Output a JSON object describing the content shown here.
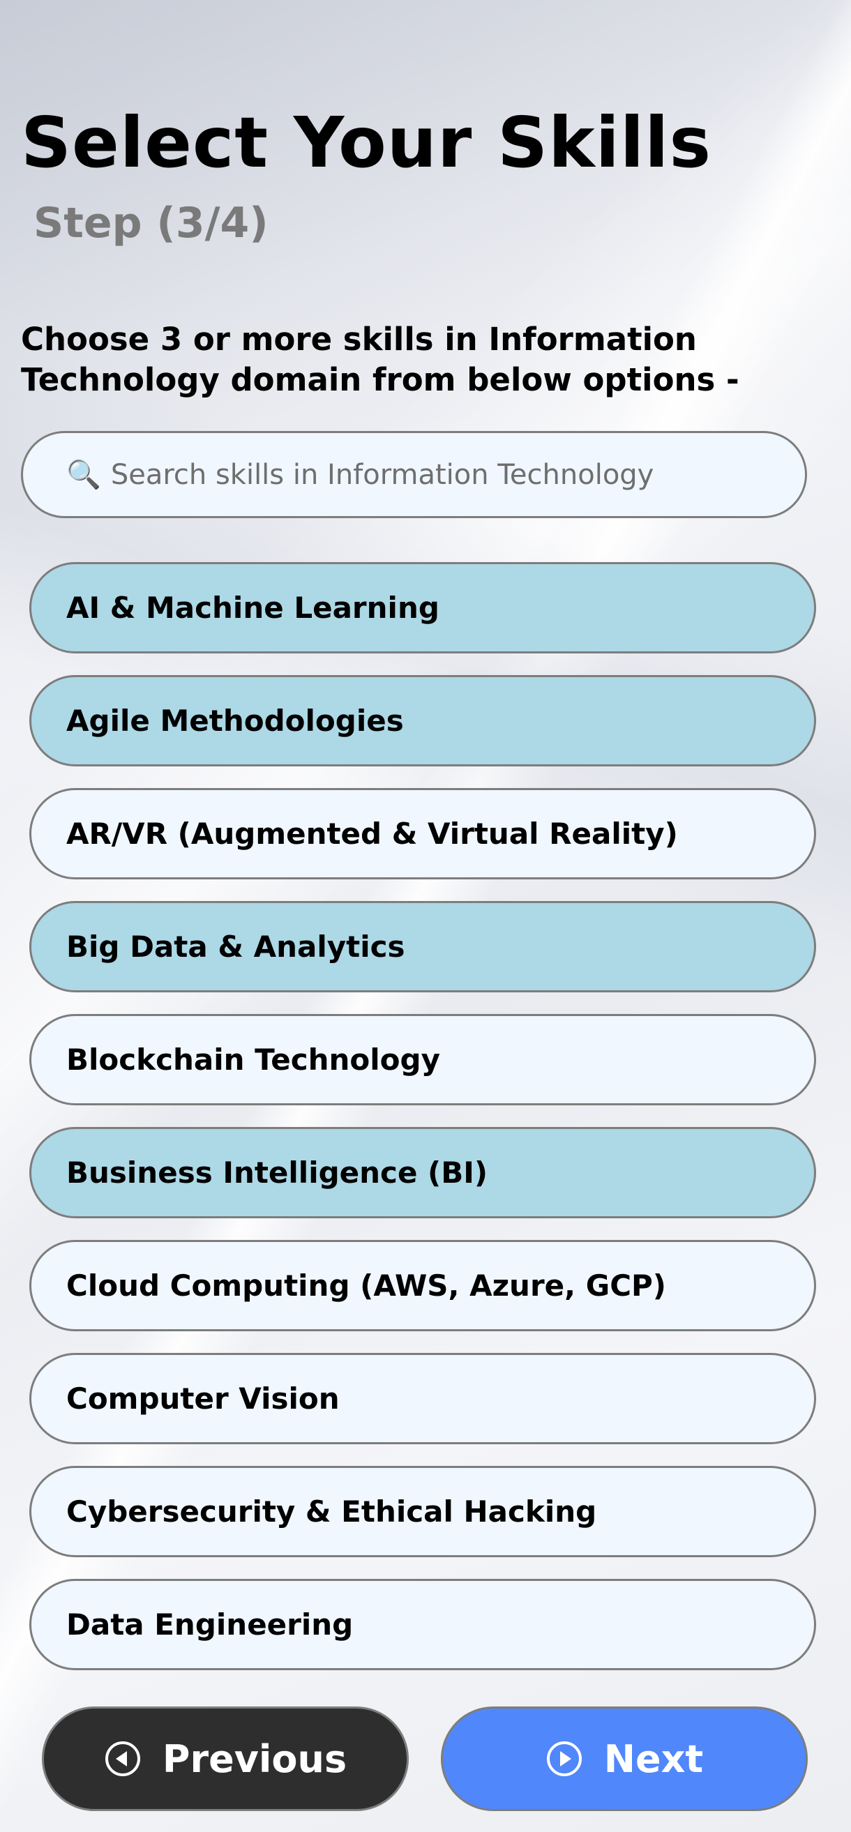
{
  "header": {
    "title": "Select Your Skills",
    "step": "Step (3/4)"
  },
  "instructions": "Choose 3 or more skills in Information Technology domain from below options -",
  "search": {
    "placeholder": "Search skills in Information Technology",
    "value": "",
    "icon": "magnifier-icon"
  },
  "skills": [
    {
      "label": "AI & Machine Learning",
      "selected": true
    },
    {
      "label": "Agile Methodologies",
      "selected": true
    },
    {
      "label": "AR/VR (Augmented & Virtual Reality)",
      "selected": false
    },
    {
      "label": "Big Data & Analytics",
      "selected": true
    },
    {
      "label": "Blockchain Technology",
      "selected": false
    },
    {
      "label": "Business Intelligence (BI)",
      "selected": true
    },
    {
      "label": "Cloud Computing (AWS, Azure, GCP)",
      "selected": false
    },
    {
      "label": "Computer Vision",
      "selected": false
    },
    {
      "label": "Cybersecurity & Ethical Hacking",
      "selected": false
    },
    {
      "label": "Data Engineering",
      "selected": false
    }
  ],
  "navigation": {
    "previous_label": "Previous",
    "next_label": "Next",
    "previous_icon": "circle-arrow-left-icon",
    "next_icon": "circle-arrow-right-icon"
  },
  "colors": {
    "selected_skill": "#add8e6",
    "unselected_skill": "#f0f7ff",
    "previous_button": "#2e2e2e",
    "next_button": "#5087fb",
    "step_text": "#7a7a7a"
  }
}
